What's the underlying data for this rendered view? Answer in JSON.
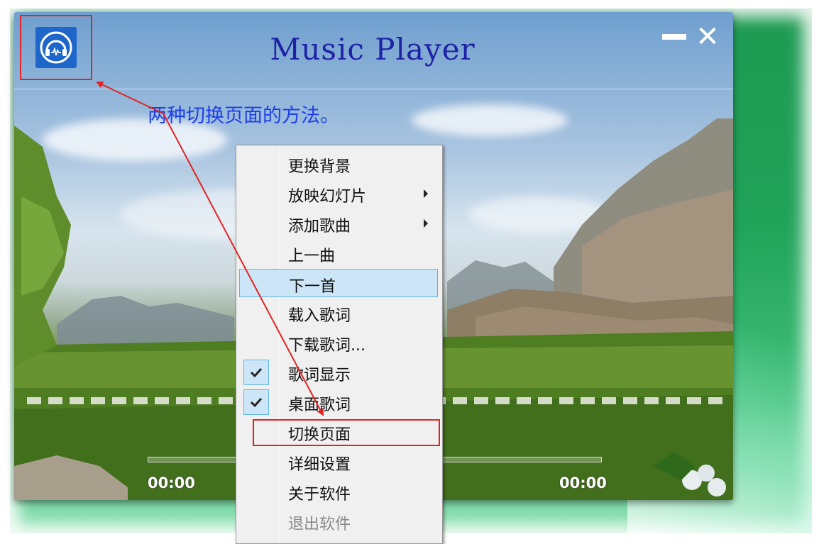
{
  "window": {
    "title": "Music Player",
    "min_label": "",
    "close_label": "✕"
  },
  "annotation": {
    "text": "两种切换页面的方法。"
  },
  "player": {
    "time_current": "00:00",
    "time_total": "00:00"
  },
  "context_menu": {
    "items": [
      {
        "label": "更换背景"
      },
      {
        "label": "放映幻灯片",
        "submenu": true
      },
      {
        "label": "添加歌曲",
        "submenu": true
      },
      {
        "label": "上一曲"
      },
      {
        "label": "下一首",
        "highlighted": true
      },
      {
        "label": "载入歌词"
      },
      {
        "label": "下载歌词..."
      },
      {
        "label": "歌词显示",
        "checked": true
      },
      {
        "label": "桌面歌词",
        "checked": true
      },
      {
        "label": "切换页面",
        "annotated": true
      },
      {
        "label": "详细设置"
      },
      {
        "label": "关于软件"
      },
      {
        "label": "退出软件"
      }
    ]
  },
  "colors": {
    "annotation_red": "#e02424",
    "title_blue": "#1f22a5",
    "annotation_text_blue": "#1d3fe6",
    "menu_highlight": "#cde6f7",
    "desktop_green": "#21a259"
  },
  "icons": {
    "app": "headphones-icon",
    "minimize": "minimize-icon",
    "close": "close-icon",
    "checked": "checkmark-icon",
    "submenu": "chevron-right-icon"
  }
}
